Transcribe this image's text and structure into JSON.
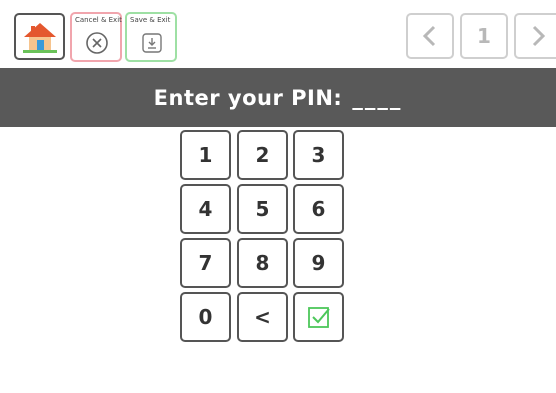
{
  "toolbar": {
    "home_icon": "home-icon",
    "cancel_label": "Cancel & Exit",
    "cancel_icon": "circle-x-icon",
    "save_label": "Save & Exit",
    "save_icon": "download-icon",
    "prev_icon": "chevron-left-icon",
    "page_number": "1",
    "next_icon": "chevron-right-icon"
  },
  "header": {
    "title": "Enter your PIN:",
    "pin_display": "____"
  },
  "keypad": {
    "keys": [
      "1",
      "2",
      "3",
      "4",
      "5",
      "6",
      "7",
      "8",
      "9",
      "0",
      "<"
    ],
    "submit_icon": "checkbox-check-icon"
  },
  "colors": {
    "header_bg": "#595959",
    "cancel_border": "#f1a5ad",
    "save_border": "#9ee0a4",
    "check_green": "#4cc75a"
  }
}
